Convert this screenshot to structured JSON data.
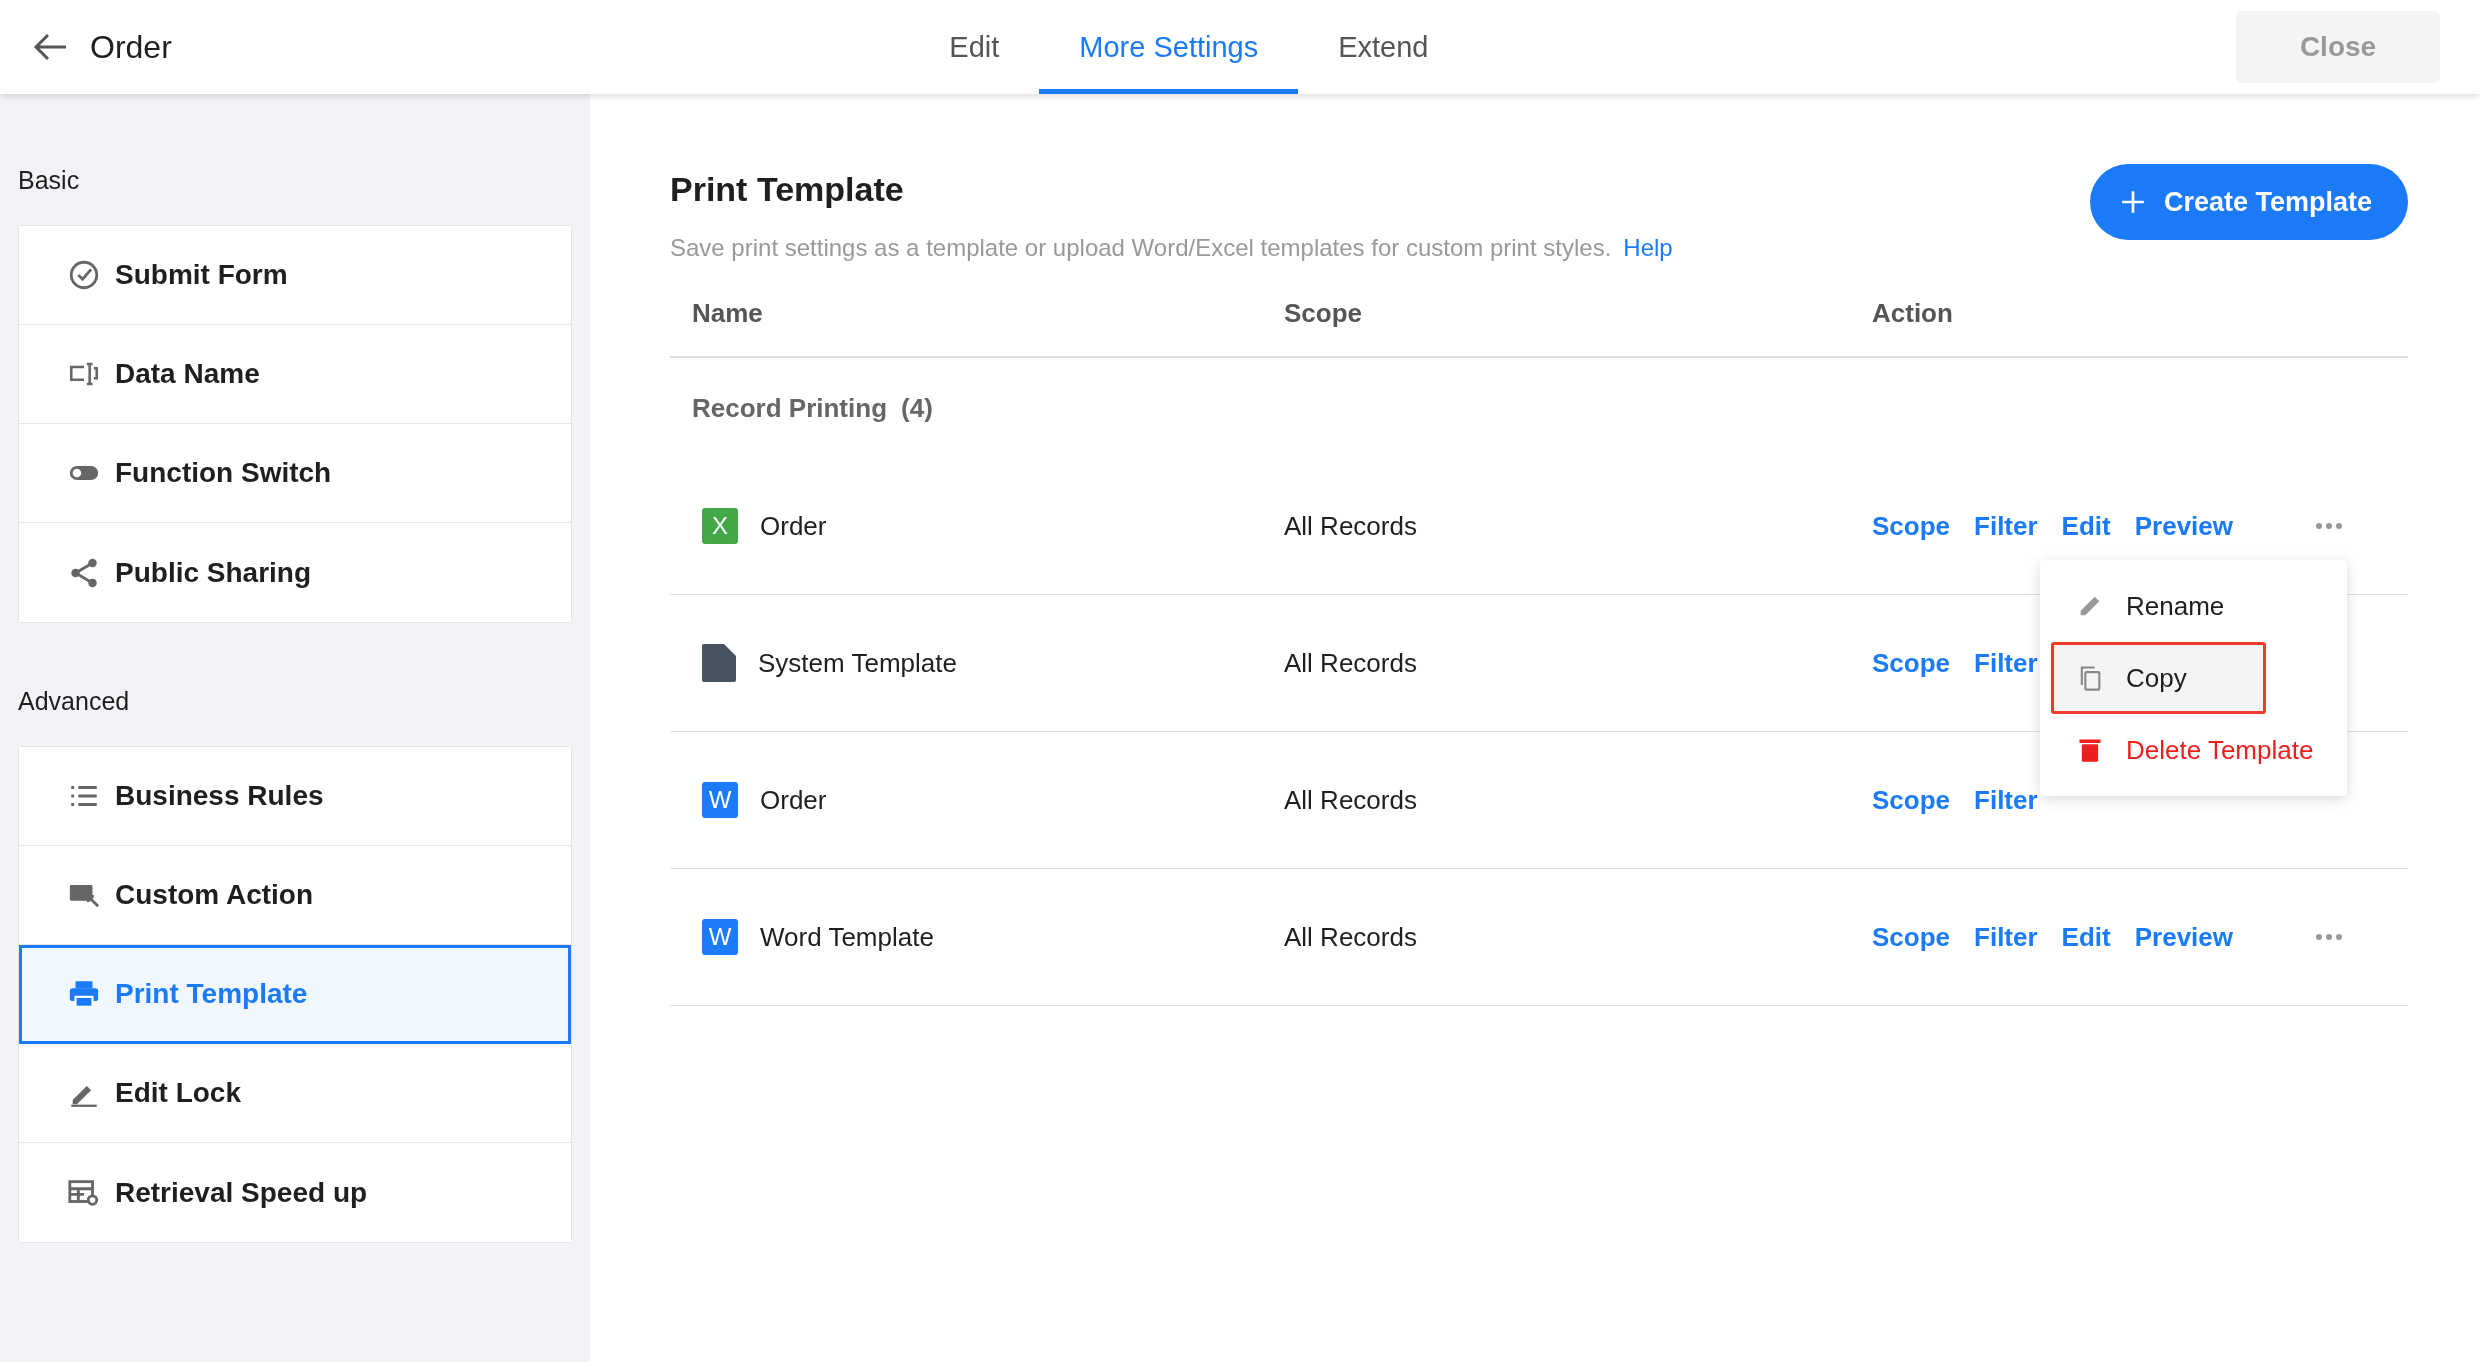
{
  "header": {
    "title": "Order",
    "tabs": [
      {
        "label": "Edit",
        "selected": false
      },
      {
        "label": "More Settings",
        "selected": true
      },
      {
        "label": "Extend",
        "selected": false
      }
    ],
    "close_button": "Close"
  },
  "sidebar": {
    "groups": [
      {
        "label": "Basic",
        "items": [
          {
            "label": "Submit Form",
            "selected": false
          },
          {
            "label": "Data Name",
            "selected": false
          },
          {
            "label": "Function Switch",
            "selected": false
          },
          {
            "label": "Public Sharing",
            "selected": false
          }
        ]
      },
      {
        "label": "Advanced",
        "items": [
          {
            "label": "Business Rules",
            "selected": false
          },
          {
            "label": "Custom Action",
            "selected": false
          },
          {
            "label": "Print Template",
            "selected": true
          },
          {
            "label": "Edit Lock",
            "selected": false
          },
          {
            "label": "Retrieval Speed up",
            "selected": false
          }
        ]
      }
    ]
  },
  "main": {
    "title": "Print Template",
    "create_button": "Create Template",
    "description": "Save print settings as a template or upload Word/Excel templates for custom print styles.",
    "help_link": "Help",
    "table": {
      "columns": [
        "Name",
        "Scope",
        "Action"
      ],
      "section": {
        "label": "Record Printing",
        "count": "(4)"
      },
      "rows": [
        {
          "kind": "excel",
          "badge": "X",
          "name": "Order",
          "scope": "All Records",
          "actions": [
            "Scope",
            "Filter",
            "Edit",
            "Preview"
          ],
          "has_more": true
        },
        {
          "kind": "document",
          "name": "System Template",
          "scope": "All Records",
          "actions": [
            "Scope",
            "Filter"
          ],
          "has_more": false
        },
        {
          "kind": "word",
          "badge": "W",
          "name": "Order",
          "scope": "All Records",
          "actions": [
            "Scope",
            "Filter"
          ],
          "has_more": false
        },
        {
          "kind": "word",
          "badge": "W",
          "name": "Word Template",
          "scope": "All Records",
          "actions": [
            "Scope",
            "Filter",
            "Edit",
            "Preview"
          ],
          "has_more": true
        }
      ]
    },
    "context_menu": {
      "items": [
        {
          "kind": "rename",
          "label": "Rename",
          "selected": false
        },
        {
          "kind": "copy",
          "label": "Copy",
          "selected": true
        },
        {
          "kind": "delete",
          "label": "Delete Template",
          "selected": false
        }
      ]
    }
  }
}
